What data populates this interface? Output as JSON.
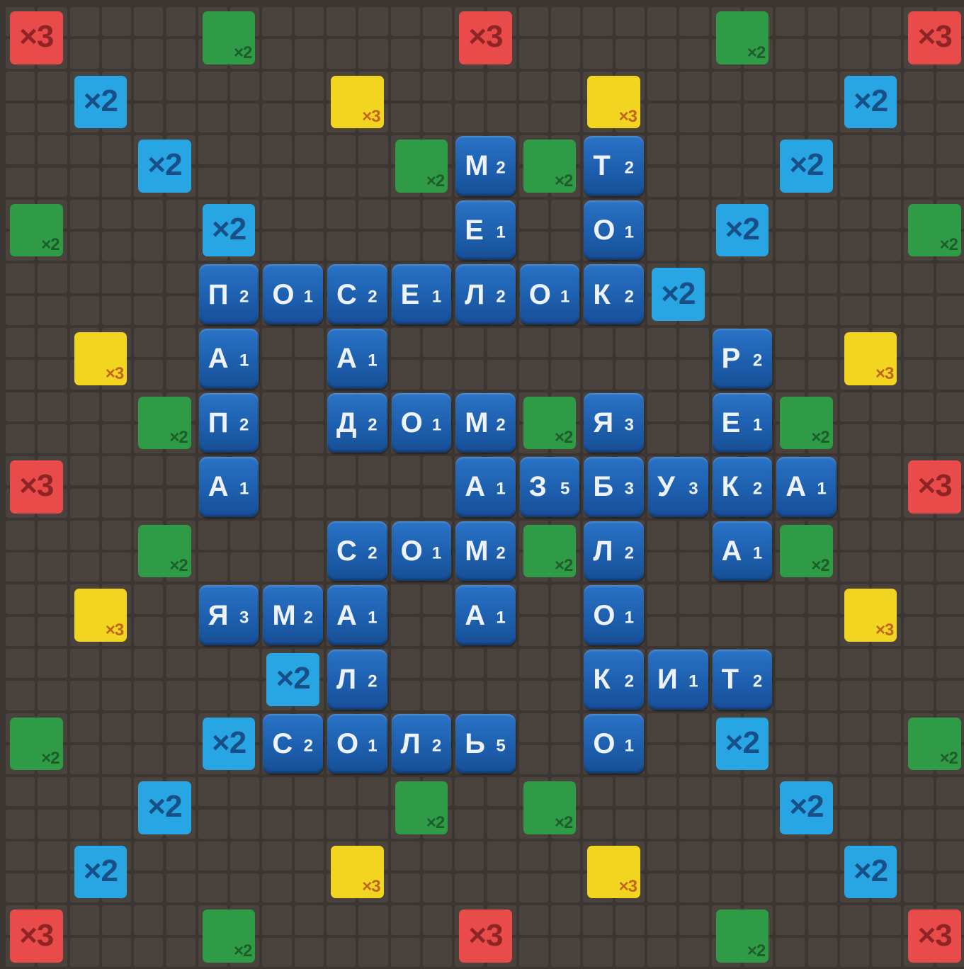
{
  "board": {
    "size": 15,
    "premium_labels": {
      "x2": "×2",
      "x3": "×3"
    },
    "premium_colors": {
      "red": "#e94b4b",
      "green": "#2f9b46",
      "blue": "#27a6e3",
      "yellow": "#f2d520"
    },
    "premium_text_colors": {
      "red": "#8e2424",
      "green": "#1c5d2a",
      "blue": "#174f86",
      "yellow": "#c0651a"
    },
    "premiums": [
      {
        "row": 0,
        "col": 0,
        "type": "red",
        "label": "×3"
      },
      {
        "row": 0,
        "col": 3,
        "type": "green",
        "label": "×2"
      },
      {
        "row": 0,
        "col": 7,
        "type": "red",
        "label": "×3"
      },
      {
        "row": 0,
        "col": 11,
        "type": "green",
        "label": "×2"
      },
      {
        "row": 0,
        "col": 14,
        "type": "red",
        "label": "×3"
      },
      {
        "row": 1,
        "col": 1,
        "type": "blue",
        "label": "×2"
      },
      {
        "row": 1,
        "col": 5,
        "type": "yellow",
        "label": "×3"
      },
      {
        "row": 1,
        "col": 9,
        "type": "yellow",
        "label": "×3"
      },
      {
        "row": 1,
        "col": 13,
        "type": "blue",
        "label": "×2"
      },
      {
        "row": 2,
        "col": 2,
        "type": "blue",
        "label": "×2"
      },
      {
        "row": 2,
        "col": 6,
        "type": "green",
        "label": "×2"
      },
      {
        "row": 2,
        "col": 8,
        "type": "green",
        "label": "×2"
      },
      {
        "row": 2,
        "col": 12,
        "type": "blue",
        "label": "×2"
      },
      {
        "row": 3,
        "col": 0,
        "type": "green",
        "label": "×2"
      },
      {
        "row": 3,
        "col": 3,
        "type": "blue",
        "label": "×2"
      },
      {
        "row": 3,
        "col": 11,
        "type": "blue",
        "label": "×2"
      },
      {
        "row": 3,
        "col": 14,
        "type": "green",
        "label": "×2"
      },
      {
        "row": 4,
        "col": 10,
        "type": "blue",
        "label": "×2"
      },
      {
        "row": 5,
        "col": 1,
        "type": "yellow",
        "label": "×3"
      },
      {
        "row": 5,
        "col": 13,
        "type": "yellow",
        "label": "×3"
      },
      {
        "row": 6,
        "col": 2,
        "type": "green",
        "label": "×2"
      },
      {
        "row": 6,
        "col": 8,
        "type": "green",
        "label": "×2"
      },
      {
        "row": 6,
        "col": 12,
        "type": "green",
        "label": "×2"
      },
      {
        "row": 7,
        "col": 0,
        "type": "red",
        "label": "×3"
      },
      {
        "row": 7,
        "col": 14,
        "type": "red",
        "label": "×3"
      },
      {
        "row": 8,
        "col": 2,
        "type": "green",
        "label": "×2"
      },
      {
        "row": 8,
        "col": 8,
        "type": "green",
        "label": "×2"
      },
      {
        "row": 8,
        "col": 12,
        "type": "green",
        "label": "×2"
      },
      {
        "row": 9,
        "col": 1,
        "type": "yellow",
        "label": "×3"
      },
      {
        "row": 9,
        "col": 13,
        "type": "yellow",
        "label": "×3"
      },
      {
        "row": 10,
        "col": 4,
        "type": "blue",
        "label": "×2"
      },
      {
        "row": 11,
        "col": 0,
        "type": "green",
        "label": "×2"
      },
      {
        "row": 11,
        "col": 3,
        "type": "blue",
        "label": "×2"
      },
      {
        "row": 11,
        "col": 11,
        "type": "blue",
        "label": "×2"
      },
      {
        "row": 11,
        "col": 14,
        "type": "green",
        "label": "×2"
      },
      {
        "row": 12,
        "col": 2,
        "type": "blue",
        "label": "×2"
      },
      {
        "row": 12,
        "col": 6,
        "type": "green",
        "label": "×2"
      },
      {
        "row": 12,
        "col": 8,
        "type": "green",
        "label": "×2"
      },
      {
        "row": 12,
        "col": 12,
        "type": "blue",
        "label": "×2"
      },
      {
        "row": 13,
        "col": 1,
        "type": "blue",
        "label": "×2"
      },
      {
        "row": 13,
        "col": 5,
        "type": "yellow",
        "label": "×3"
      },
      {
        "row": 13,
        "col": 9,
        "type": "yellow",
        "label": "×3"
      },
      {
        "row": 13,
        "col": 13,
        "type": "blue",
        "label": "×2"
      },
      {
        "row": 14,
        "col": 0,
        "type": "red",
        "label": "×3"
      },
      {
        "row": 14,
        "col": 3,
        "type": "green",
        "label": "×2"
      },
      {
        "row": 14,
        "col": 7,
        "type": "red",
        "label": "×3"
      },
      {
        "row": 14,
        "col": 11,
        "type": "green",
        "label": "×2"
      },
      {
        "row": 14,
        "col": 14,
        "type": "red",
        "label": "×3"
      }
    ],
    "tile_color": "#1d5fae",
    "tiles": [
      {
        "row": 2,
        "col": 7,
        "letter": "М",
        "points": "2"
      },
      {
        "row": 2,
        "col": 9,
        "letter": "Т",
        "points": "2"
      },
      {
        "row": 3,
        "col": 7,
        "letter": "Е",
        "points": "1"
      },
      {
        "row": 3,
        "col": 9,
        "letter": "О",
        "points": "1"
      },
      {
        "row": 4,
        "col": 3,
        "letter": "П",
        "points": "2"
      },
      {
        "row": 4,
        "col": 4,
        "letter": "О",
        "points": "1"
      },
      {
        "row": 4,
        "col": 5,
        "letter": "С",
        "points": "2"
      },
      {
        "row": 4,
        "col": 6,
        "letter": "Е",
        "points": "1"
      },
      {
        "row": 4,
        "col": 7,
        "letter": "Л",
        "points": "2"
      },
      {
        "row": 4,
        "col": 8,
        "letter": "О",
        "points": "1"
      },
      {
        "row": 4,
        "col": 9,
        "letter": "К",
        "points": "2"
      },
      {
        "row": 5,
        "col": 3,
        "letter": "А",
        "points": "1"
      },
      {
        "row": 5,
        "col": 5,
        "letter": "А",
        "points": "1"
      },
      {
        "row": 5,
        "col": 11,
        "letter": "Р",
        "points": "2"
      },
      {
        "row": 6,
        "col": 3,
        "letter": "П",
        "points": "2"
      },
      {
        "row": 6,
        "col": 5,
        "letter": "Д",
        "points": "2"
      },
      {
        "row": 6,
        "col": 6,
        "letter": "О",
        "points": "1"
      },
      {
        "row": 6,
        "col": 7,
        "letter": "М",
        "points": "2"
      },
      {
        "row": 6,
        "col": 9,
        "letter": "Я",
        "points": "3"
      },
      {
        "row": 6,
        "col": 11,
        "letter": "Е",
        "points": "1"
      },
      {
        "row": 7,
        "col": 3,
        "letter": "А",
        "points": "1"
      },
      {
        "row": 7,
        "col": 7,
        "letter": "А",
        "points": "1"
      },
      {
        "row": 7,
        "col": 8,
        "letter": "З",
        "points": "5"
      },
      {
        "row": 7,
        "col": 9,
        "letter": "Б",
        "points": "3"
      },
      {
        "row": 7,
        "col": 10,
        "letter": "У",
        "points": "3"
      },
      {
        "row": 7,
        "col": 11,
        "letter": "К",
        "points": "2"
      },
      {
        "row": 7,
        "col": 12,
        "letter": "А",
        "points": "1"
      },
      {
        "row": 8,
        "col": 5,
        "letter": "С",
        "points": "2"
      },
      {
        "row": 8,
        "col": 6,
        "letter": "О",
        "points": "1"
      },
      {
        "row": 8,
        "col": 7,
        "letter": "М",
        "points": "2"
      },
      {
        "row": 8,
        "col": 9,
        "letter": "Л",
        "points": "2"
      },
      {
        "row": 8,
        "col": 11,
        "letter": "А",
        "points": "1"
      },
      {
        "row": 9,
        "col": 3,
        "letter": "Я",
        "points": "3"
      },
      {
        "row": 9,
        "col": 4,
        "letter": "М",
        "points": "2"
      },
      {
        "row": 9,
        "col": 5,
        "letter": "А",
        "points": "1"
      },
      {
        "row": 9,
        "col": 7,
        "letter": "А",
        "points": "1"
      },
      {
        "row": 9,
        "col": 9,
        "letter": "О",
        "points": "1"
      },
      {
        "row": 10,
        "col": 5,
        "letter": "Л",
        "points": "2"
      },
      {
        "row": 10,
        "col": 9,
        "letter": "К",
        "points": "2"
      },
      {
        "row": 10,
        "col": 10,
        "letter": "И",
        "points": "1"
      },
      {
        "row": 10,
        "col": 11,
        "letter": "Т",
        "points": "2"
      },
      {
        "row": 11,
        "col": 4,
        "letter": "С",
        "points": "2"
      },
      {
        "row": 11,
        "col": 5,
        "letter": "О",
        "points": "1"
      },
      {
        "row": 11,
        "col": 6,
        "letter": "Л",
        "points": "2"
      },
      {
        "row": 11,
        "col": 7,
        "letter": "Ь",
        "points": "5"
      },
      {
        "row": 11,
        "col": 9,
        "letter": "О",
        "points": "1"
      }
    ]
  }
}
